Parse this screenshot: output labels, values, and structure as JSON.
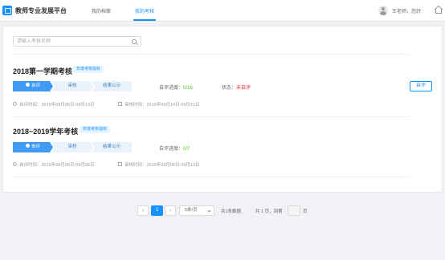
{
  "header": {
    "app_title": "教师专业发展平台",
    "nav": [
      "我的档案",
      "我的考核"
    ],
    "user": "王老师，您好"
  },
  "search": {
    "placeholder": "请输入考核名称"
  },
  "cards": [
    {
      "title": "2018第一学期考核",
      "tag": "年度考核指标",
      "steps": [
        "自评",
        "审核",
        "结果公示"
      ],
      "progress_label": "自评进度：",
      "progress_value": "0/16",
      "status_label": "状态：",
      "status_value": "未自评",
      "button": "自评",
      "self_time": "自评时间：2019年09月05日-09月13日",
      "review_time": "审核时间：2019年09月14日-09月21日"
    },
    {
      "title": "2018~2019学年考核",
      "tag": "年度考核指标",
      "steps": [
        "自评",
        "审核",
        "结果公示"
      ],
      "progress_label": "自评进度：",
      "progress_value": "0/7",
      "self_time": "自评时间：2019年09月05日-09月05日",
      "review_time": "审核时间：2019年09月06日-09月13日"
    }
  ],
  "pagination": {
    "prev": "‹",
    "page": "1",
    "next": "›",
    "page_size": "5条/页",
    "total": "共1条数据",
    "pages": "共 1 页，到第",
    "unit": "页"
  },
  "colors": {
    "primary": "#1890ff",
    "success": "#52c41a",
    "danger": "#f5222d"
  }
}
